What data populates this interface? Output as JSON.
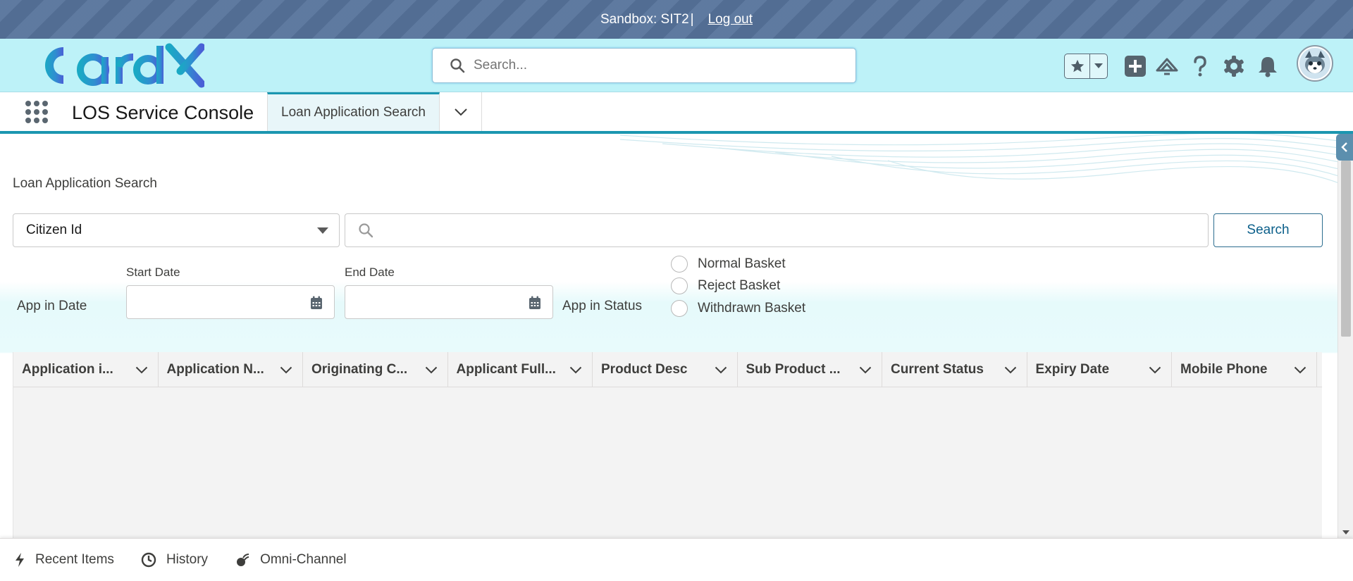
{
  "sandbox": {
    "text": "Sandbox: SIT2",
    "separator": "|",
    "logout": "Log out"
  },
  "header": {
    "logo_text": "CardX",
    "search_placeholder": "Search...",
    "icons": [
      "star-icon",
      "chevron-down-icon",
      "plus-icon",
      "trailhead-icon",
      "help-icon",
      "gear-icon",
      "bell-icon",
      "avatar"
    ]
  },
  "nav": {
    "app_name": "LOS Service Console",
    "active_tab": "Loan Application Search"
  },
  "page": {
    "title": "Loan Application Search",
    "search_by": "Citizen Id",
    "search_value": "",
    "search_button": "Search",
    "app_in_date_label": "App in Date",
    "start_date_label": "Start Date",
    "end_date_label": "End Date",
    "app_in_status_label": "App in Status",
    "status_options": [
      "Normal Basket",
      "Reject Basket",
      "Withdrawn Basket"
    ]
  },
  "table": {
    "columns": [
      "Application i...",
      "Application N...",
      "Originating C...",
      "Applicant Full...",
      "Product Desc",
      "Sub Product ...",
      "Current Status",
      "Expiry Date",
      "Mobile Phone"
    ],
    "rows": []
  },
  "utility_bar": {
    "items": [
      "Recent Items",
      "History",
      "Omni-Channel"
    ]
  },
  "colors": {
    "header_bg": "#bdf2f8",
    "sandbox_bg": "#56739b",
    "accent": "#1b96b0",
    "button_text": "#0b5f8a"
  }
}
